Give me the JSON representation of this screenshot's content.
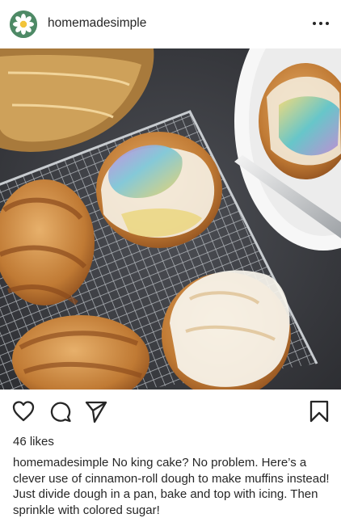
{
  "post": {
    "username": "homemadesimple",
    "likes": "46 likes",
    "caption_user": "homemadesimple",
    "caption_text": "No king cake? No problem. Here’s a clever use of cinnamon-roll dough to make muffins instead! Just divide dough in a pan, bake and top with icing. Then sprinkle with colored sugar!"
  },
  "icons": {
    "avatar": "daisy-avatar-icon",
    "more": "more-options-icon",
    "like": "heart-icon",
    "comment": "comment-icon",
    "share": "paper-plane-icon",
    "save": "bookmark-icon"
  },
  "colors": {
    "text": "#262626",
    "avatar_bg": "#4e8a66"
  }
}
